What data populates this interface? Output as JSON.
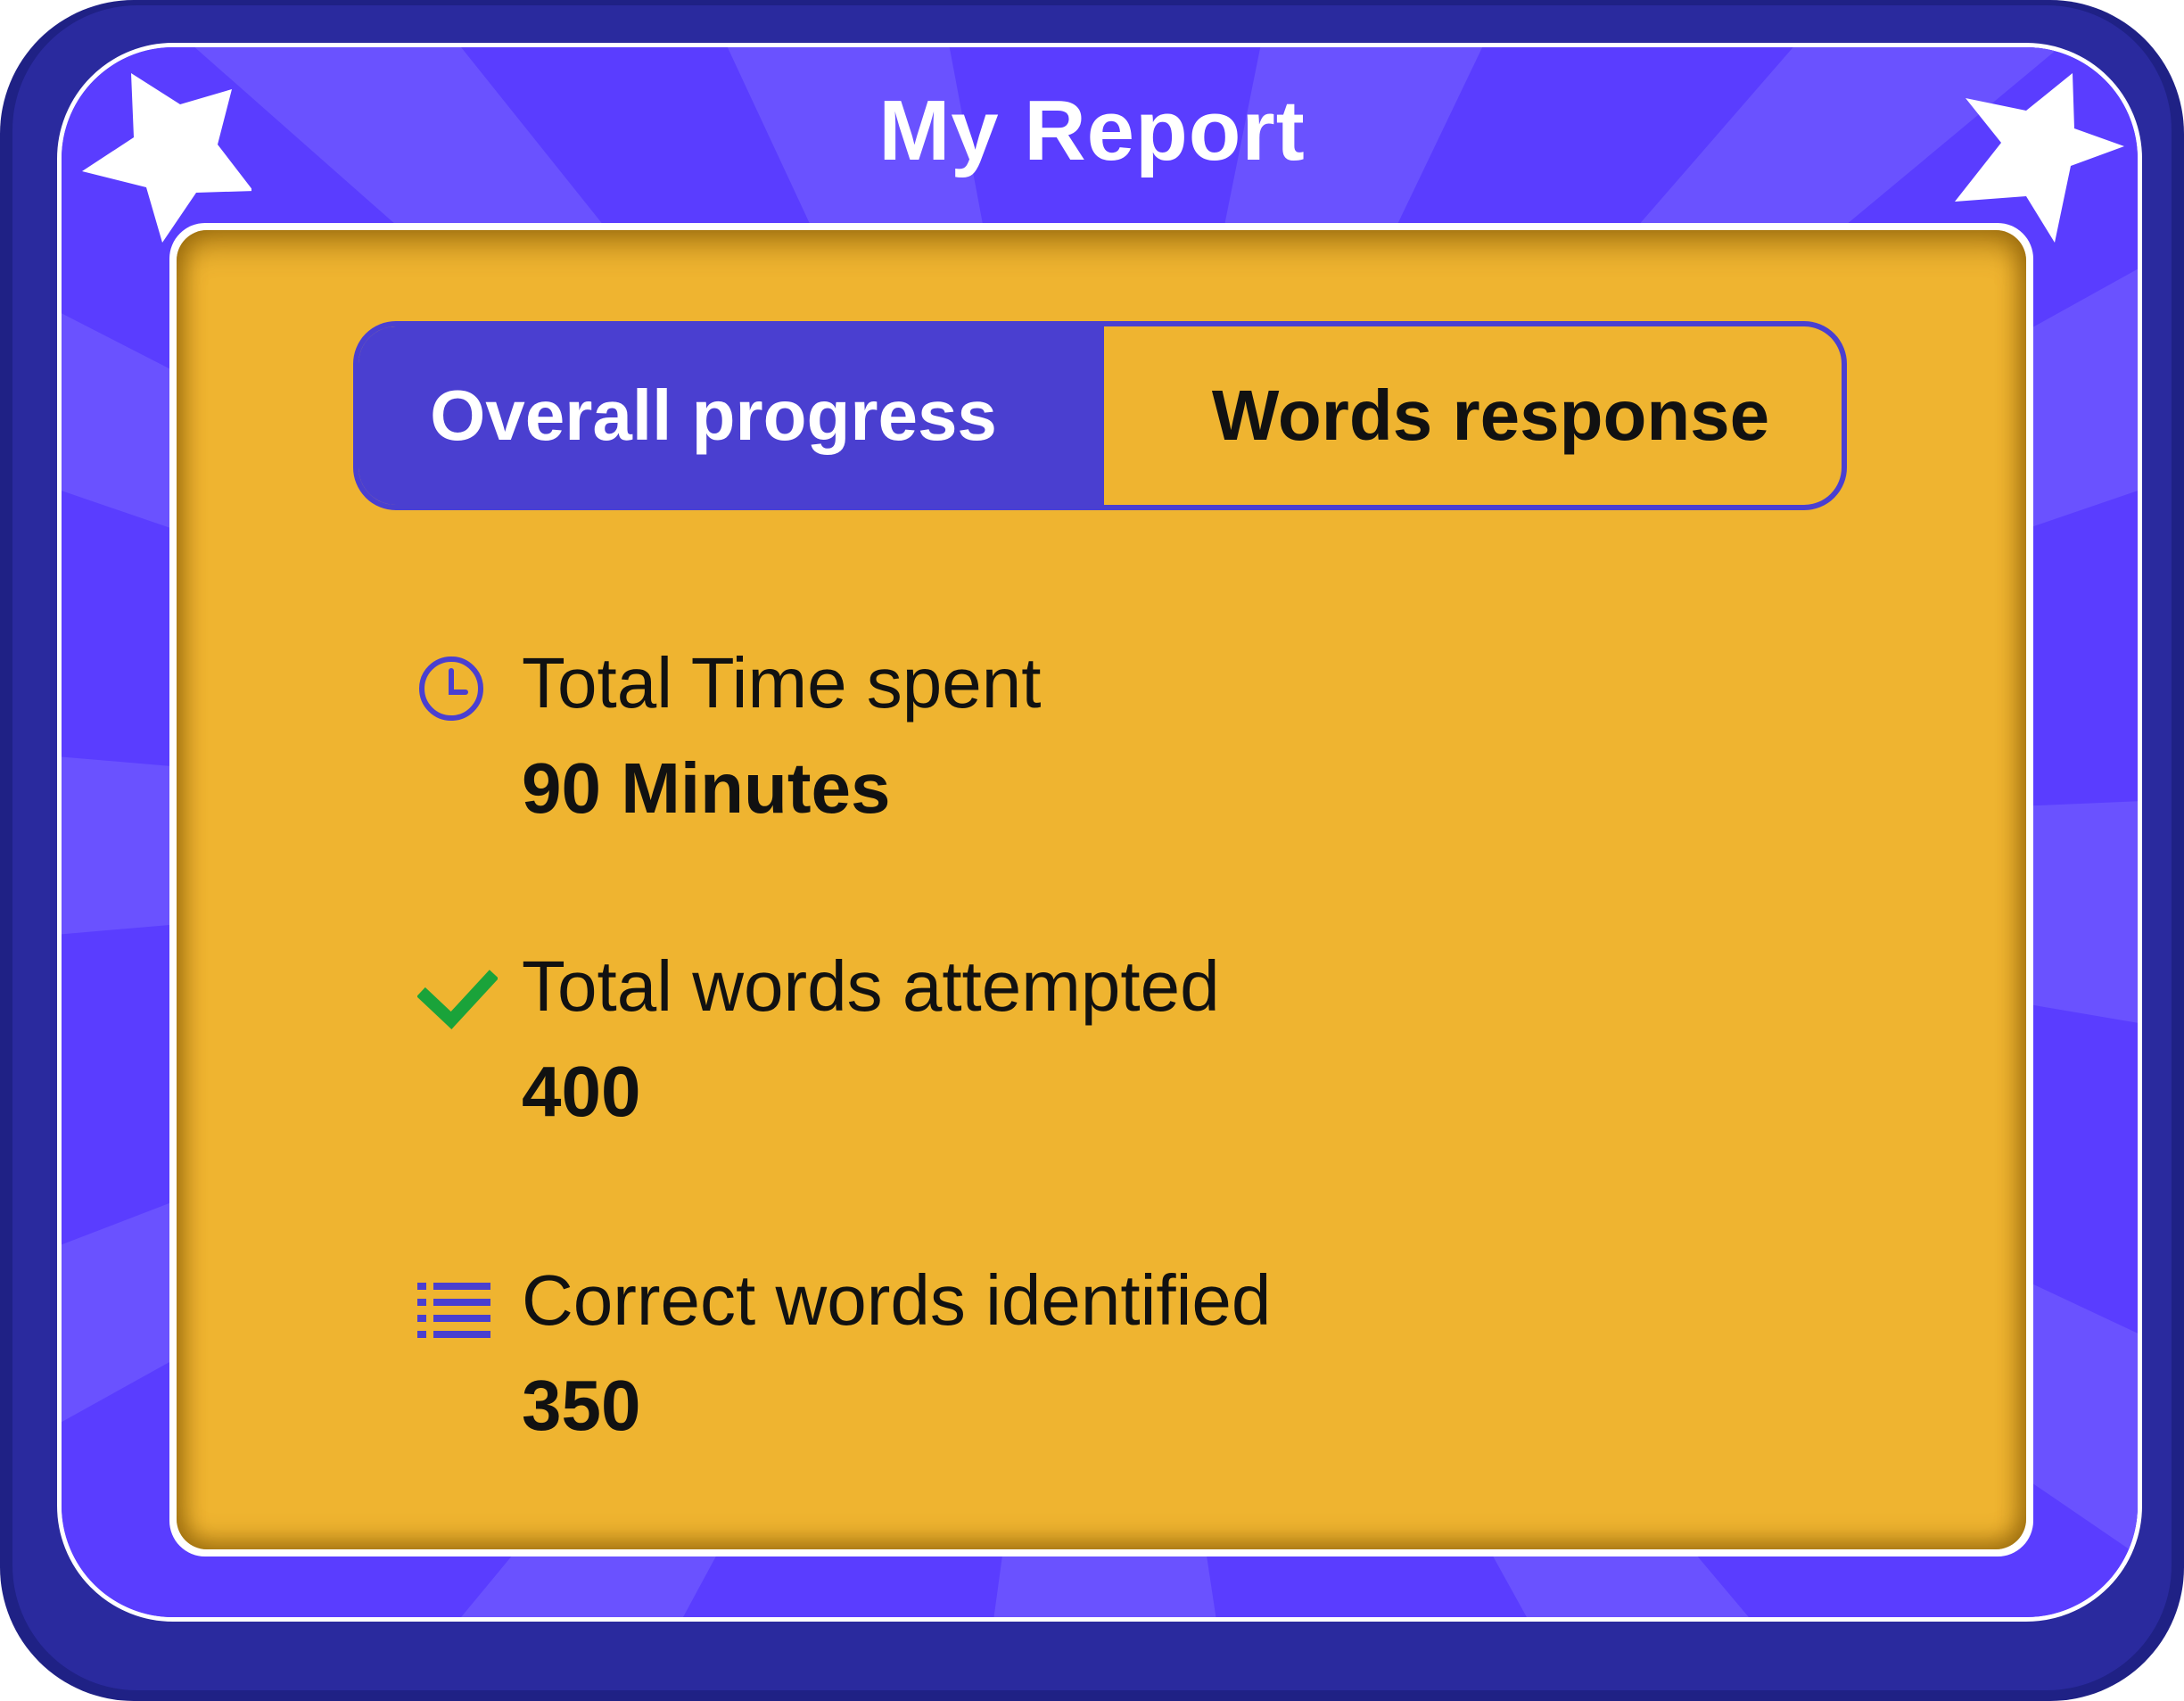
{
  "header": {
    "title": "My Report"
  },
  "tabs": [
    {
      "label": "Overall progress",
      "active": true
    },
    {
      "label": "Words response",
      "active": false
    }
  ],
  "stats": [
    {
      "label": "Total Time spent",
      "value": "90 Minutes",
      "icon": "clock-icon"
    },
    {
      "label": "Total words attempted",
      "value": "400",
      "icon": "checkmark-icon"
    },
    {
      "label": "Correct words identified",
      "value": "350",
      "icon": "list-icon"
    }
  ],
  "colors": {
    "frame": "#1f2185",
    "panel": "#5a3dff",
    "card": "#efb430",
    "accent": "#4a3fd0",
    "check": "#1aa33a"
  }
}
